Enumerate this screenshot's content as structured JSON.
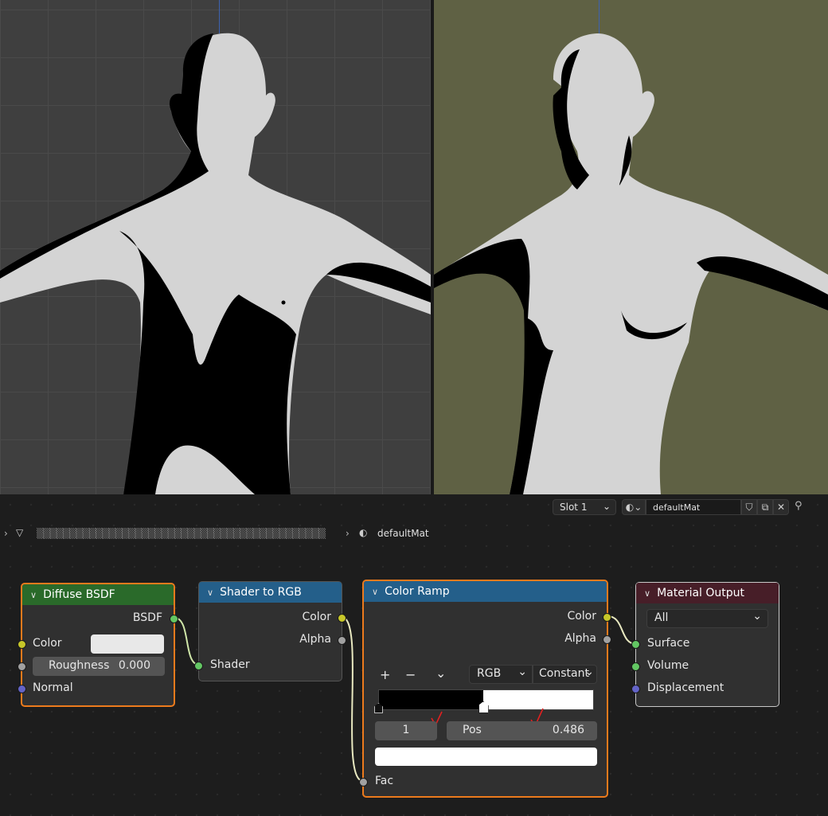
{
  "header": {
    "slot_label": "Slot 1",
    "material_name": "defaultMat",
    "breadcrumb_object": "▒▒▒▒▒▒▒▒▒▒▒▒▒▒▒▒▒▒▒▒▒▒▒▒▒▒▒▒▒▒▒▒▒▒▒▒▒▒▒▒▒▒▒▒",
    "breadcrumb_material": "defaultMat"
  },
  "nodes": {
    "diffuse": {
      "title": "Diffuse BSDF",
      "output": "BSDF",
      "inputs": {
        "color": "Color",
        "roughness_label": "Roughness",
        "roughness_value": "0.000",
        "normal": "Normal"
      }
    },
    "shader_to_rgb": {
      "title": "Shader to RGB",
      "outputs": {
        "color": "Color",
        "alpha": "Alpha"
      },
      "input": "Shader"
    },
    "color_ramp": {
      "title": "Color Ramp",
      "outputs": {
        "color": "Color",
        "alpha": "Alpha"
      },
      "add": "+",
      "remove": "−",
      "menu": "⌄",
      "color_mode": "RGB",
      "interpolation": "Constant",
      "stop_index": "1",
      "pos_label": "Pos",
      "pos_value": "0.486",
      "stop_position": 0.486,
      "input": "Fac"
    },
    "material_output": {
      "title": "Material Output",
      "target": "All",
      "inputs": {
        "surface": "Surface",
        "volume": "Volume",
        "displacement": "Displacement"
      }
    }
  },
  "colors": {
    "accent_orange": "#ec7a1c",
    "diffuse_header": "#2a6a2a",
    "converter_header": "#245f8a",
    "output_header": "#471e28"
  }
}
